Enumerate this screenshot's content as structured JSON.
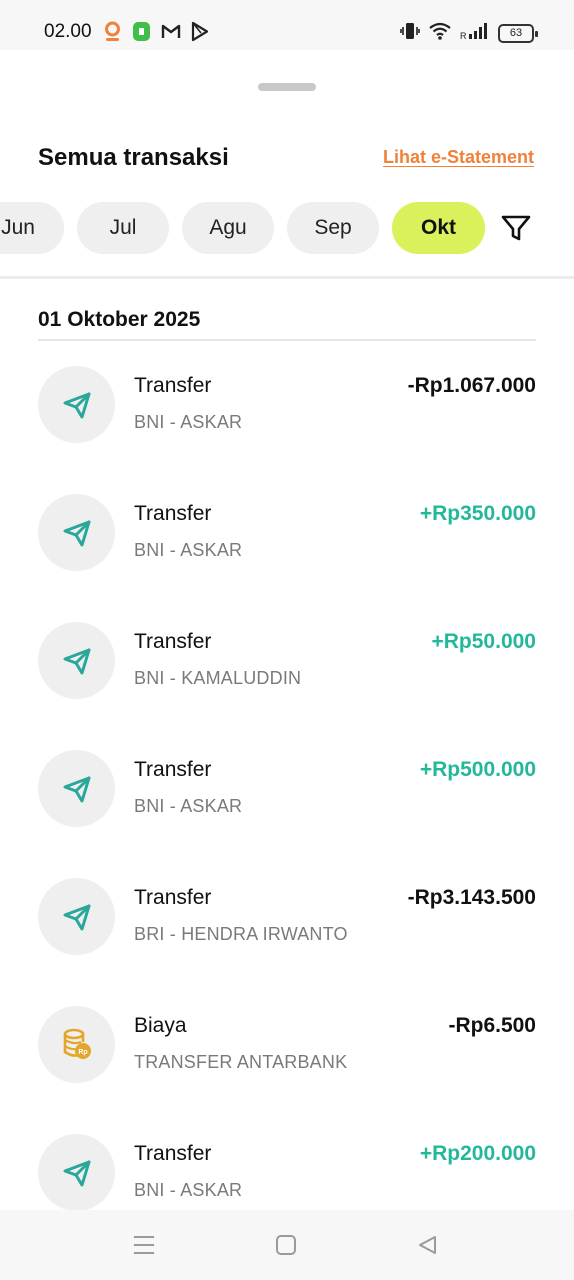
{
  "status_bar": {
    "time": "02.00",
    "battery": "63",
    "icons_left": [
      "location-icon",
      "app-icon",
      "gmail-icon",
      "play-icon"
    ],
    "icons_right": [
      "vibrate-icon",
      "wifi-icon",
      "signal-icon",
      "battery-icon"
    ]
  },
  "header": {
    "title": "Semua transaksi",
    "estatement_link": "Lihat e-Statement"
  },
  "months": [
    {
      "label": "Jun",
      "active": false
    },
    {
      "label": "Jul",
      "active": false
    },
    {
      "label": "Agu",
      "active": false
    },
    {
      "label": "Sep",
      "active": false
    },
    {
      "label": "Okt",
      "active": true
    }
  ],
  "section": {
    "date": "01 Oktober 2025"
  },
  "transactions": [
    {
      "type": "Transfer",
      "desc": "BNI - ASKAR",
      "amount": "-Rp1.067.000",
      "direction": "out",
      "icon": "paper-plane-icon"
    },
    {
      "type": "Transfer",
      "desc": "BNI - ASKAR",
      "amount": "+Rp350.000",
      "direction": "in",
      "icon": "paper-plane-icon"
    },
    {
      "type": "Transfer",
      "desc": "BNI - KAMALUDDIN",
      "amount": "+Rp50.000",
      "direction": "in",
      "icon": "paper-plane-icon"
    },
    {
      "type": "Transfer",
      "desc": "BNI - ASKAR",
      "amount": "+Rp500.000",
      "direction": "in",
      "icon": "paper-plane-icon"
    },
    {
      "type": "Transfer",
      "desc": "BRI - HENDRA IRWANTO",
      "amount": "-Rp3.143.500",
      "direction": "out",
      "icon": "paper-plane-icon"
    },
    {
      "type": "Biaya",
      "desc": "TRANSFER ANTARBANK",
      "amount": "-Rp6.500",
      "direction": "out",
      "icon": "coins-icon"
    },
    {
      "type": "Transfer",
      "desc": "BNI - ASKAR",
      "amount": "+Rp200.000",
      "direction": "in",
      "icon": "paper-plane-icon"
    }
  ],
  "colors": {
    "accent_active_chip": "#daf15c",
    "positive_amount": "#23b89a",
    "link": "#f0813a",
    "icon_teal": "#2aa79b",
    "fee_icon": "#e3a62b"
  }
}
